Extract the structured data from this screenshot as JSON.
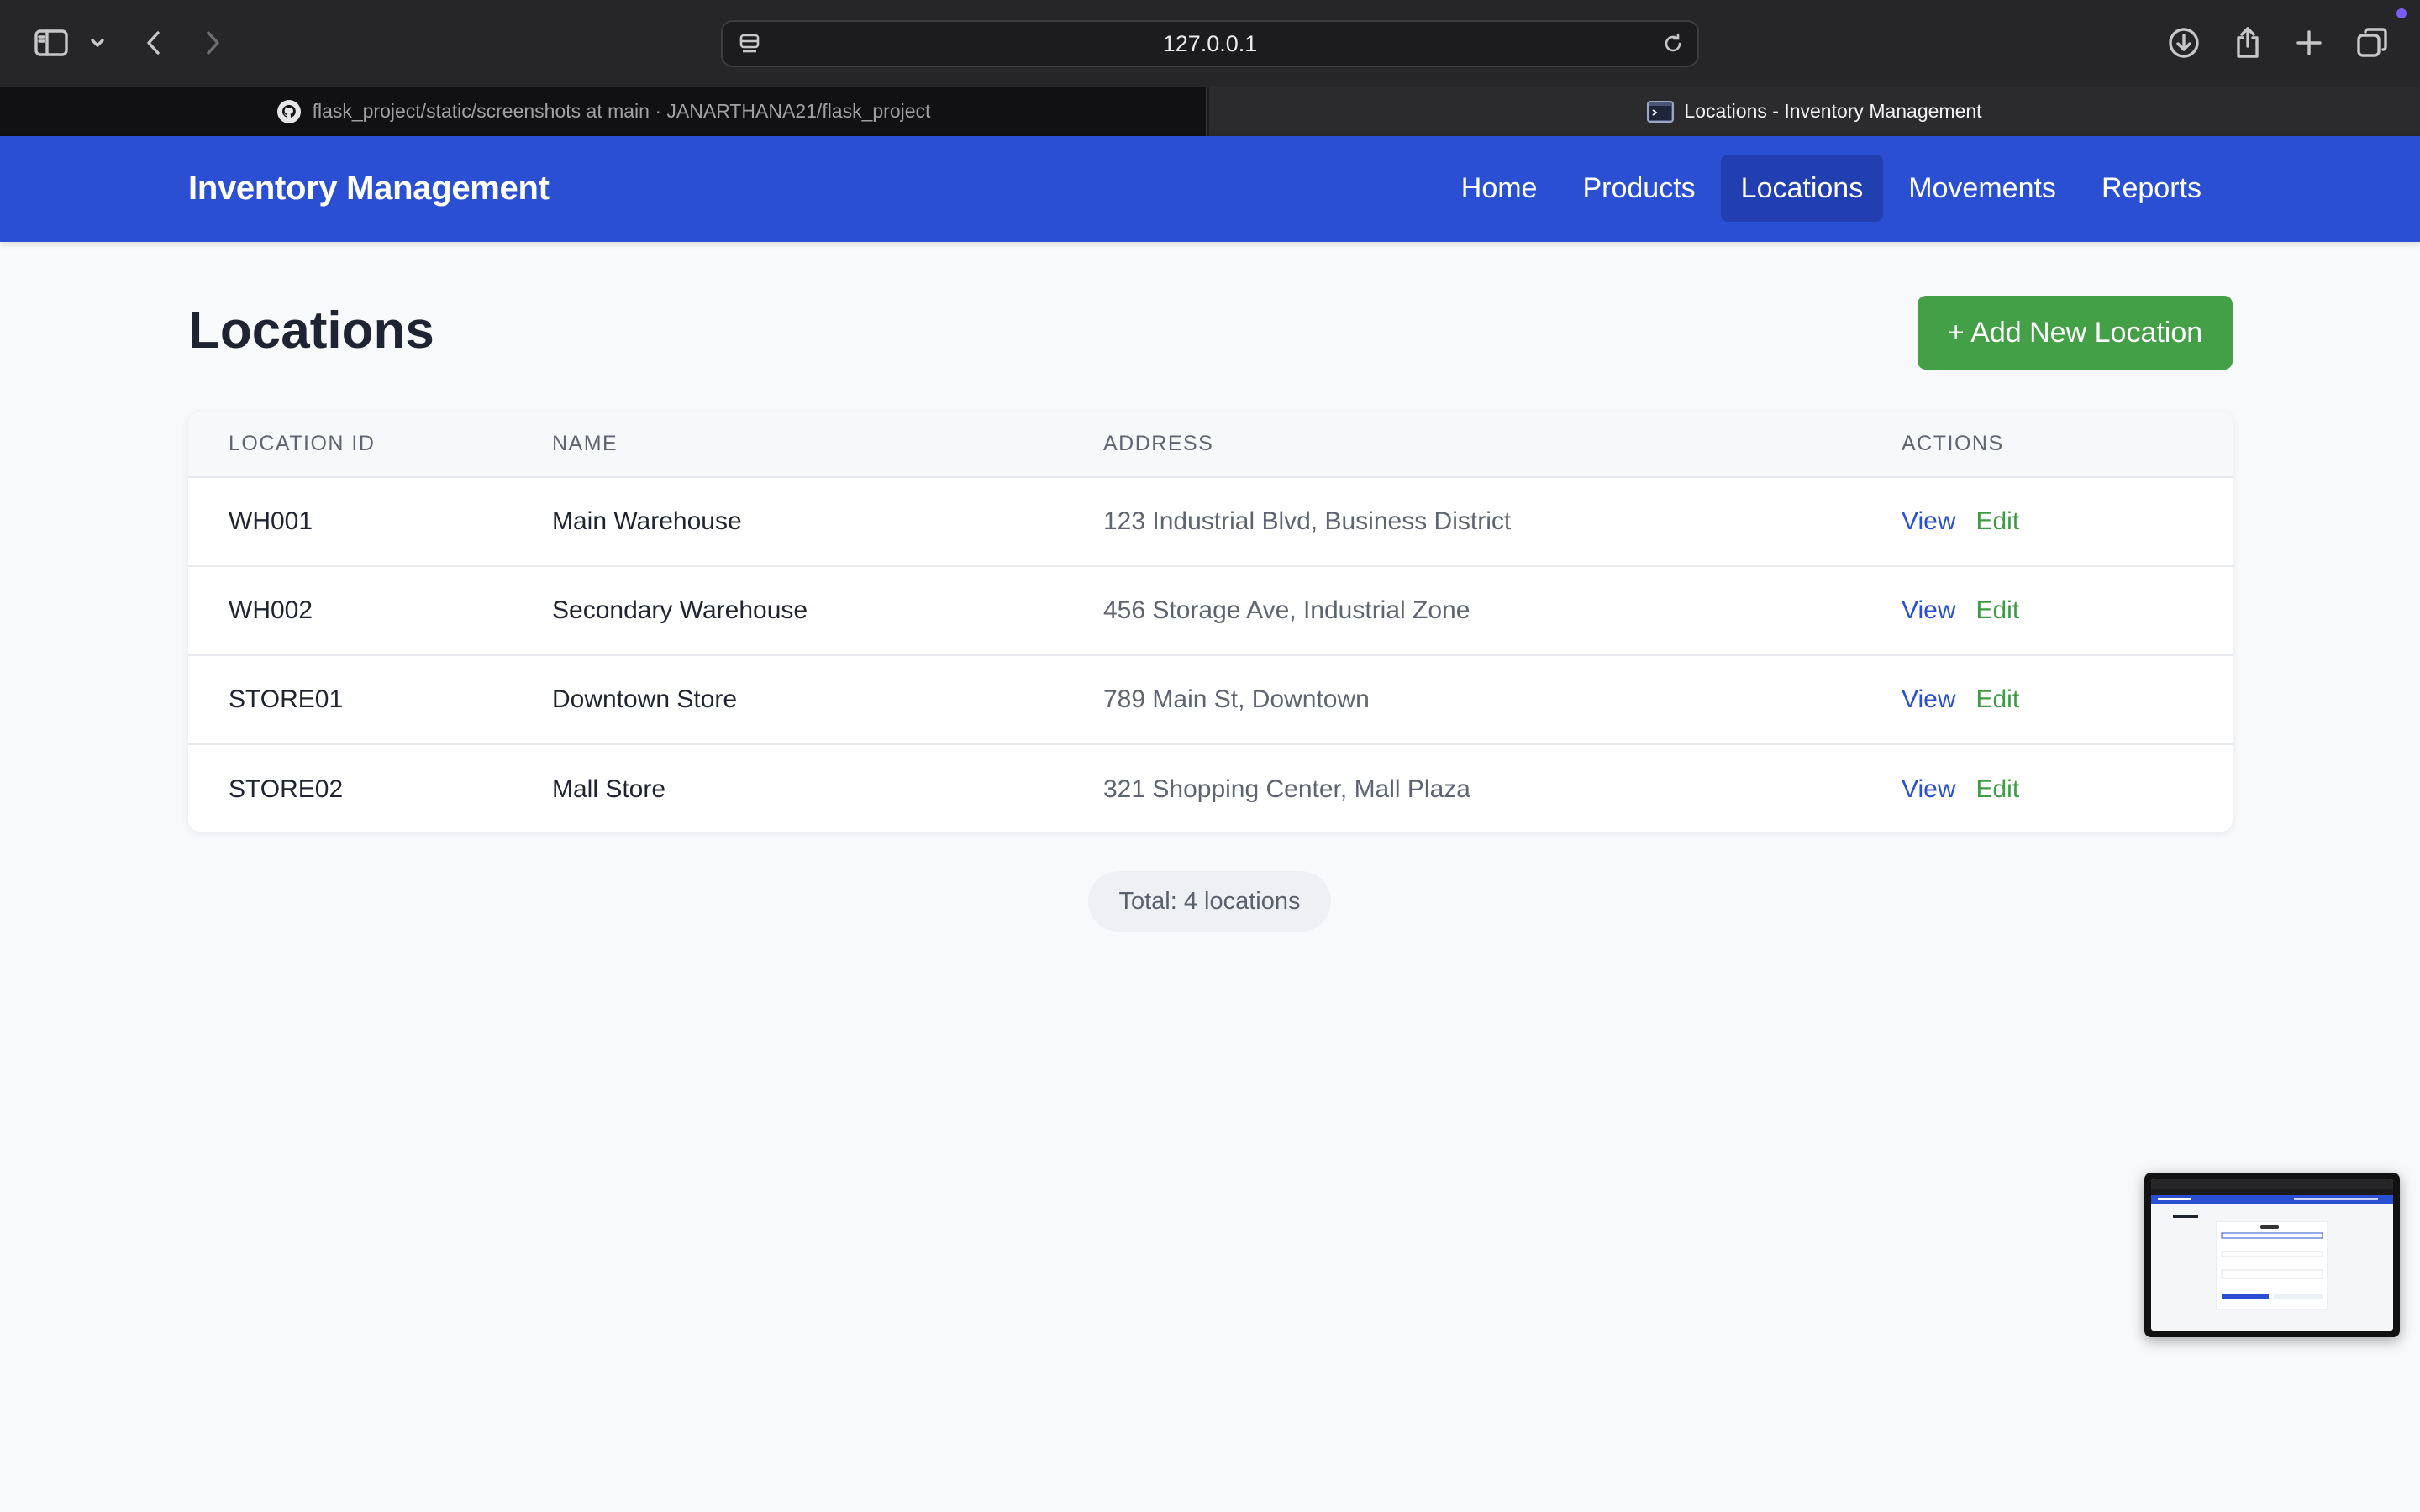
{
  "browser": {
    "url": "127.0.0.1",
    "tabs": [
      {
        "title": "flask_project/static/screenshots at main · JANARTHANA21/flask_project",
        "icon": "github-icon",
        "active": false
      },
      {
        "title": "Locations - Inventory Management",
        "icon": "terminal-icon",
        "active": true
      }
    ],
    "toolbar_icons": [
      "sidebar-icon",
      "chevron-down-icon",
      "back-icon",
      "forward-icon",
      "download-icon",
      "share-icon",
      "plus-icon",
      "tabs-overview-icon"
    ]
  },
  "app": {
    "brand": "Inventory Management",
    "nav": [
      {
        "label": "Home",
        "active": false
      },
      {
        "label": "Products",
        "active": false
      },
      {
        "label": "Locations",
        "active": true
      },
      {
        "label": "Movements",
        "active": false
      },
      {
        "label": "Reports",
        "active": false
      }
    ],
    "colors": {
      "primary": "#2a4fd3",
      "success": "#44a047"
    }
  },
  "page": {
    "title": "Locations",
    "add_button": "+ Add New Location",
    "table": {
      "headers": [
        "LOCATION ID",
        "NAME",
        "ADDRESS",
        "ACTIONS"
      ],
      "rows": [
        {
          "id": "WH001",
          "name": "Main Warehouse",
          "address": "123 Industrial Blvd, Business District"
        },
        {
          "id": "WH002",
          "name": "Secondary Warehouse",
          "address": "456 Storage Ave, Industrial Zone"
        },
        {
          "id": "STORE01",
          "name": "Downtown Store",
          "address": "789 Main St, Downtown"
        },
        {
          "id": "STORE02",
          "name": "Mall Store",
          "address": "321 Shopping Center, Mall Plaza"
        }
      ],
      "actions": {
        "view": "View",
        "edit": "Edit"
      }
    },
    "total": "Total: 4 locations"
  }
}
